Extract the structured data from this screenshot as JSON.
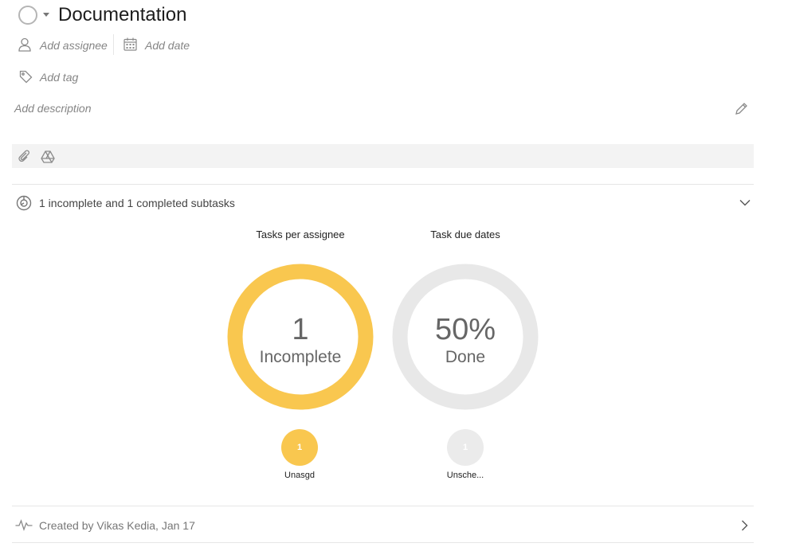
{
  "task": {
    "title": "Documentation",
    "add_assignee": "Add assignee",
    "add_date": "Add date",
    "add_tag": "Add tag",
    "add_description": "Add description"
  },
  "subtasks": {
    "summary": "1 incomplete and 1 completed subtasks"
  },
  "charts": {
    "assignee": {
      "title": "Tasks per assignee",
      "center_value": "1",
      "center_label": "Incomplete",
      "badge_value": "1",
      "badge_label": "Unasgd"
    },
    "due_dates": {
      "title": "Task due dates",
      "center_value": "50%",
      "center_label": "Done",
      "badge_value": "1",
      "badge_label": "Unsche..."
    }
  },
  "activity": {
    "created_text": "Created by Vikas Kedia, Jan 17"
  },
  "colors": {
    "accent_yellow": "#f9c74f",
    "ring_gray": "#e8e8e8",
    "badge_gray": "#ebebeb"
  }
}
